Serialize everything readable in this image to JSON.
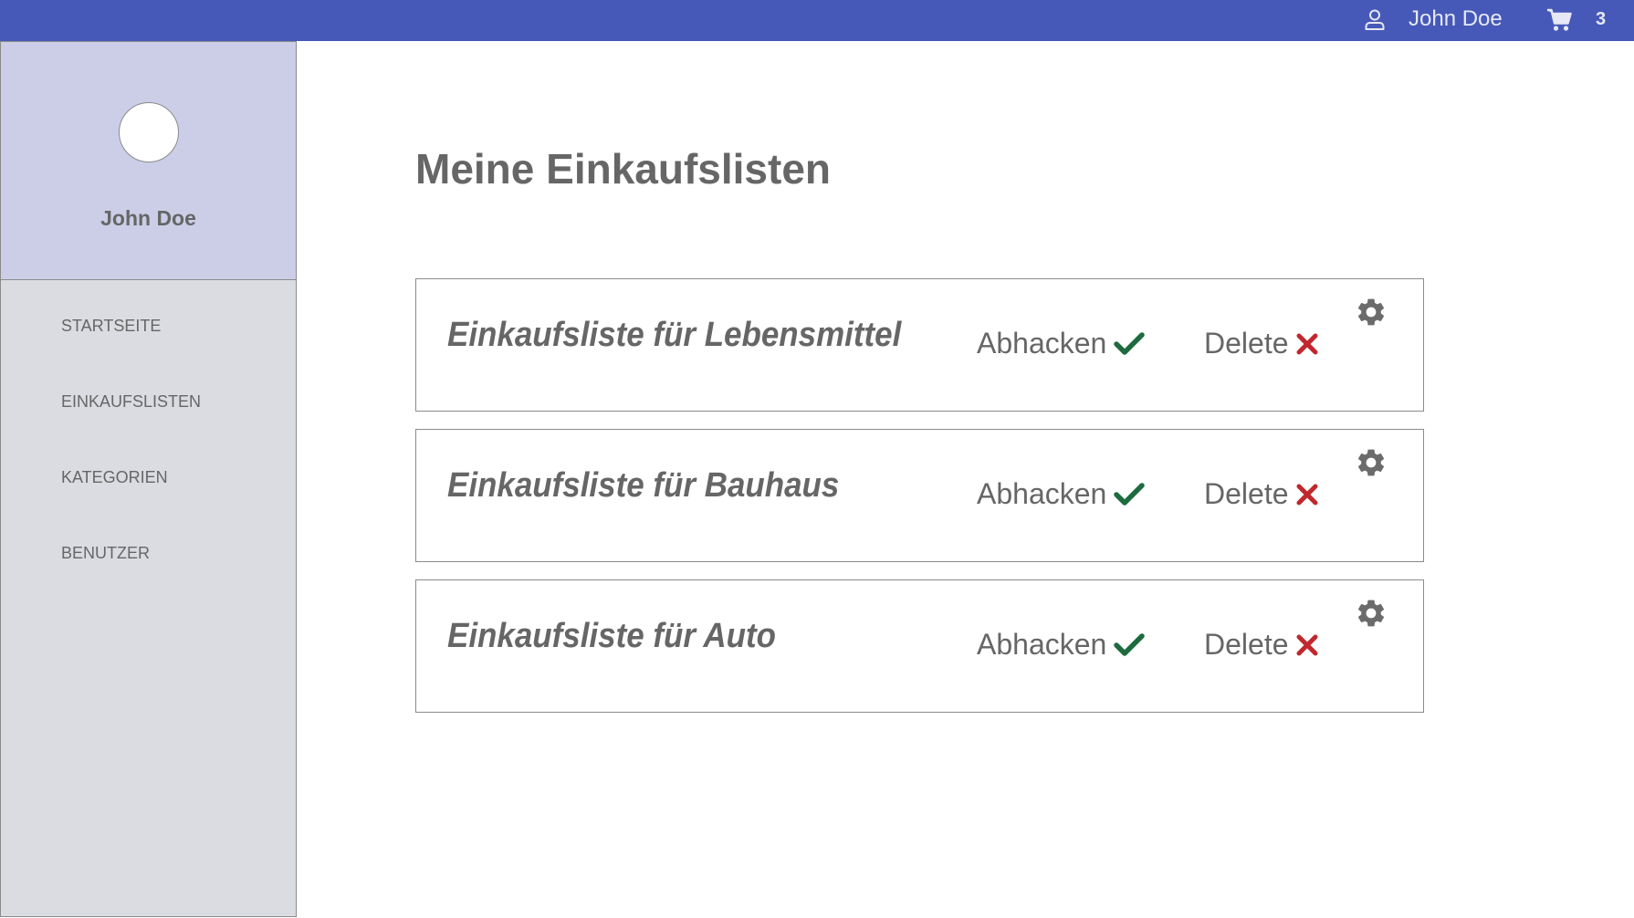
{
  "header": {
    "user_name": "John Doe",
    "cart_count": "3",
    "icons": [
      "user-icon",
      "cart-icon"
    ]
  },
  "sidebar": {
    "profile_name": "John Doe",
    "items": [
      {
        "label": "STARTSEITE"
      },
      {
        "label": "EINKAUFSLISTEN"
      },
      {
        "label": "KATEGORIEN"
      },
      {
        "label": "BENUTZER"
      }
    ]
  },
  "main": {
    "title": "Meine Einkaufslisten",
    "lists": [
      {
        "name": "Einkaufsliste für Lebensmittel",
        "check_label": "Abhacken",
        "delete_label": "Delete"
      },
      {
        "name": "Einkaufsliste für Bauhaus",
        "check_label": "Abhacken",
        "delete_label": "Delete"
      },
      {
        "name": "Einkaufsliste für Auto",
        "check_label": "Abhacken",
        "delete_label": "Delete"
      }
    ]
  },
  "colors": {
    "topbar": "#4659b8",
    "profile_bg": "#cbcee6",
    "sidebar_bg": "#dbdce2",
    "text": "#666666",
    "check": "#1d6b3e",
    "delete": "#c0282d"
  }
}
